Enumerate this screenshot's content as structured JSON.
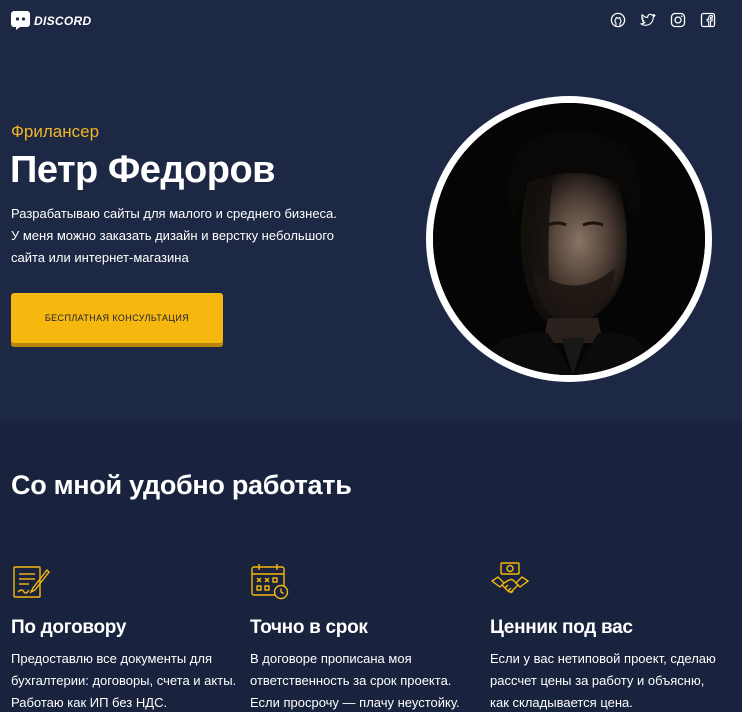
{
  "header": {
    "logo_text": "DISCORD",
    "socials": [
      {
        "icon": "github-icon"
      },
      {
        "icon": "twitter-icon"
      },
      {
        "icon": "instagram-icon"
      },
      {
        "icon": "facebook-icon"
      }
    ]
  },
  "hero": {
    "eyebrow": "Фрилансер",
    "name": "Петр Федоров",
    "lead": "Разрабатываю сайты для малого и среднего бизнеса. У меня можно заказать дизайн и верстку небольшого сайта или интернет-магазина",
    "cta_label": "БЕСПЛАТНАЯ КОНСУЛЬТАЦИЯ",
    "portrait_icon": "portrait-photo"
  },
  "features": {
    "title": "Со мной удобно работать",
    "items": [
      {
        "icon": "contract-icon",
        "title": "По договору",
        "text": "Предоставлю все документы для бухгалтерии: договоры, счета и акты. Работаю как ИП без НДС."
      },
      {
        "icon": "calendar-deadline-icon",
        "title": "Точно в срок",
        "text": "В договоре прописана моя ответственность за срок проекта. Если просрочу — плачу неустойку."
      },
      {
        "icon": "handshake-price-icon",
        "title": "Ценник под вас",
        "text": "Если у вас нетиповой проект, сделаю рассчет цены за работу и объясню, как складывается цена."
      }
    ]
  },
  "colors": {
    "accent": "#f6b80f",
    "eyebrow": "#f3b623",
    "hero_bg": "#1d2845",
    "features_bg": "#19233d"
  }
}
